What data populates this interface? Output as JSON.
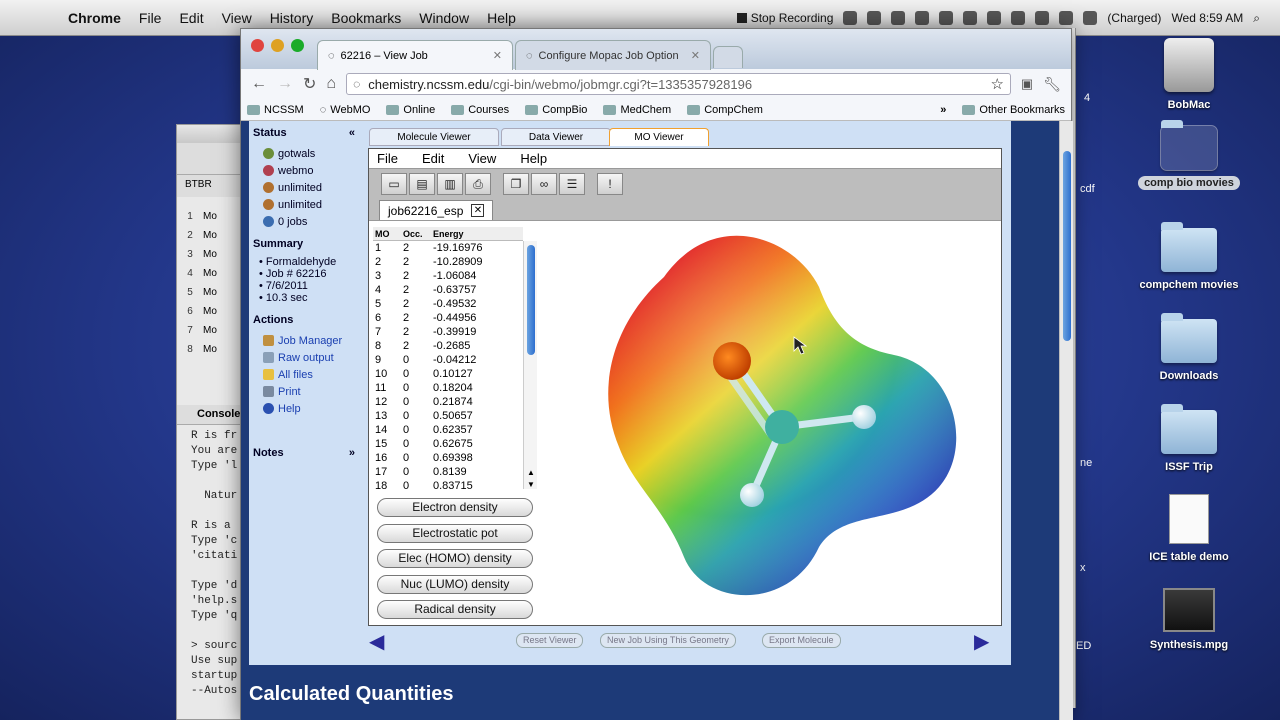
{
  "menubar": {
    "apple": "",
    "app_name": "Chrome",
    "menus": [
      "File",
      "Edit",
      "View",
      "History",
      "Bookmarks",
      "Window",
      "Help"
    ],
    "recording": "Stop Recording",
    "battery": "(Charged)",
    "clock": "Wed 8:59 AM"
  },
  "desktop": {
    "icons": [
      {
        "label": "BobMac",
        "kind": "drive"
      },
      {
        "label": "comp bio movies",
        "kind": "folder",
        "selected": true
      },
      {
        "label": "compchem movies",
        "kind": "folder"
      },
      {
        "label": "Downloads",
        "kind": "folder"
      },
      {
        "label": "ISSF Trip",
        "kind": "folder"
      },
      {
        "label": "ICE table demo",
        "kind": "doc"
      },
      {
        "label": "Synthesis.mpg",
        "kind": "movie"
      }
    ],
    "partial_labels": [
      "4",
      "cdf",
      "ne",
      "x",
      "ED"
    ]
  },
  "rwindow": {
    "tab": "BTBR",
    "rows": [
      "1",
      "2",
      "3",
      "4",
      "5",
      "6",
      "7",
      "8"
    ],
    "row_prefix": "Mo",
    "console_title": "Console",
    "console_lines": [
      "R is fr",
      "You are",
      "Type 'l",
      "",
      "  Natur",
      "",
      "R is a",
      "Type 'c",
      "'citati",
      "",
      "Type 'd",
      "'help.s",
      "Type 'q",
      "",
      "> sourc",
      "Use sup",
      "startup",
      "--Autos"
    ]
  },
  "browser": {
    "tabs": [
      {
        "title": "62216 – View Job",
        "active": true
      },
      {
        "title": "Configure Mopac Job Option",
        "active": false
      }
    ],
    "url_host": "chemistry.ncssm.edu",
    "url_path": "/cgi-bin/webmo/jobmgr.cgi?t=1335357928196",
    "bookmarks": [
      "NCSSM",
      "WebMO",
      "Online",
      "Courses",
      "CompBio",
      "MedChem",
      "CompChem"
    ],
    "other_bookmarks": "Other Bookmarks",
    "overflow": "»"
  },
  "sidebar": {
    "status_title": "Status",
    "collapse": "«",
    "status_items": [
      {
        "label": "gotwals",
        "color": "#6b8e3a"
      },
      {
        "label": "webmo",
        "color": "#b04050"
      },
      {
        "label": "unlimited",
        "color": "#b07030"
      },
      {
        "label": "unlimited",
        "color": "#b07030"
      },
      {
        "label": "0 jobs",
        "color": "#3b6db0"
      }
    ],
    "summary_title": "Summary",
    "summary_items": [
      "Formaldehyde",
      "Job # 62216",
      "7/6/2011",
      "10.3 sec"
    ],
    "actions_title": "Actions",
    "actions": [
      "Job Manager",
      "Raw output",
      "All files",
      "Print",
      "Help"
    ],
    "notes_title": "Notes",
    "notes_expand": "»"
  },
  "viewer_tabs": [
    "Molecule Viewer",
    "Data Viewer",
    "MO Viewer"
  ],
  "applet": {
    "menu": [
      "File",
      "Edit",
      "View",
      "Help"
    ],
    "job_tab": "job62216_esp",
    "table_headers": [
      "MO",
      "Occ.",
      "Energy"
    ],
    "orbitals": [
      [
        "1",
        "2",
        "-19.16976"
      ],
      [
        "2",
        "2",
        "-10.28909"
      ],
      [
        "3",
        "2",
        "-1.06084"
      ],
      [
        "4",
        "2",
        "-0.63757"
      ],
      [
        "5",
        "2",
        "-0.49532"
      ],
      [
        "6",
        "2",
        "-0.44956"
      ],
      [
        "7",
        "2",
        "-0.39919"
      ],
      [
        "8",
        "2",
        "-0.2685"
      ],
      [
        "9",
        "0",
        "-0.04212"
      ],
      [
        "10",
        "0",
        "0.10127"
      ],
      [
        "11",
        "0",
        "0.18204"
      ],
      [
        "12",
        "0",
        "0.21874"
      ],
      [
        "13",
        "0",
        "0.50657"
      ],
      [
        "14",
        "0",
        "0.62357"
      ],
      [
        "15",
        "0",
        "0.62675"
      ],
      [
        "16",
        "0",
        "0.69398"
      ],
      [
        "17",
        "0",
        "0.8139"
      ],
      [
        "18",
        "0",
        "0.83715"
      ]
    ],
    "density_buttons": [
      "Electron density",
      "Electrostatic pot",
      "Elec (HOMO) density",
      "Nuc (LUMO) density",
      "Radical density"
    ]
  },
  "bottom_buttons": [
    "Reset Viewer",
    "New Job Using This Geometry",
    "Export Molecule"
  ],
  "page_heading": "Calculated Quantities",
  "colors": {
    "accent_tab": "#f0a030",
    "link": "#1a3fb0",
    "sidebar_bg": "#cfe0f5",
    "desktop_bg": "#23378a"
  }
}
